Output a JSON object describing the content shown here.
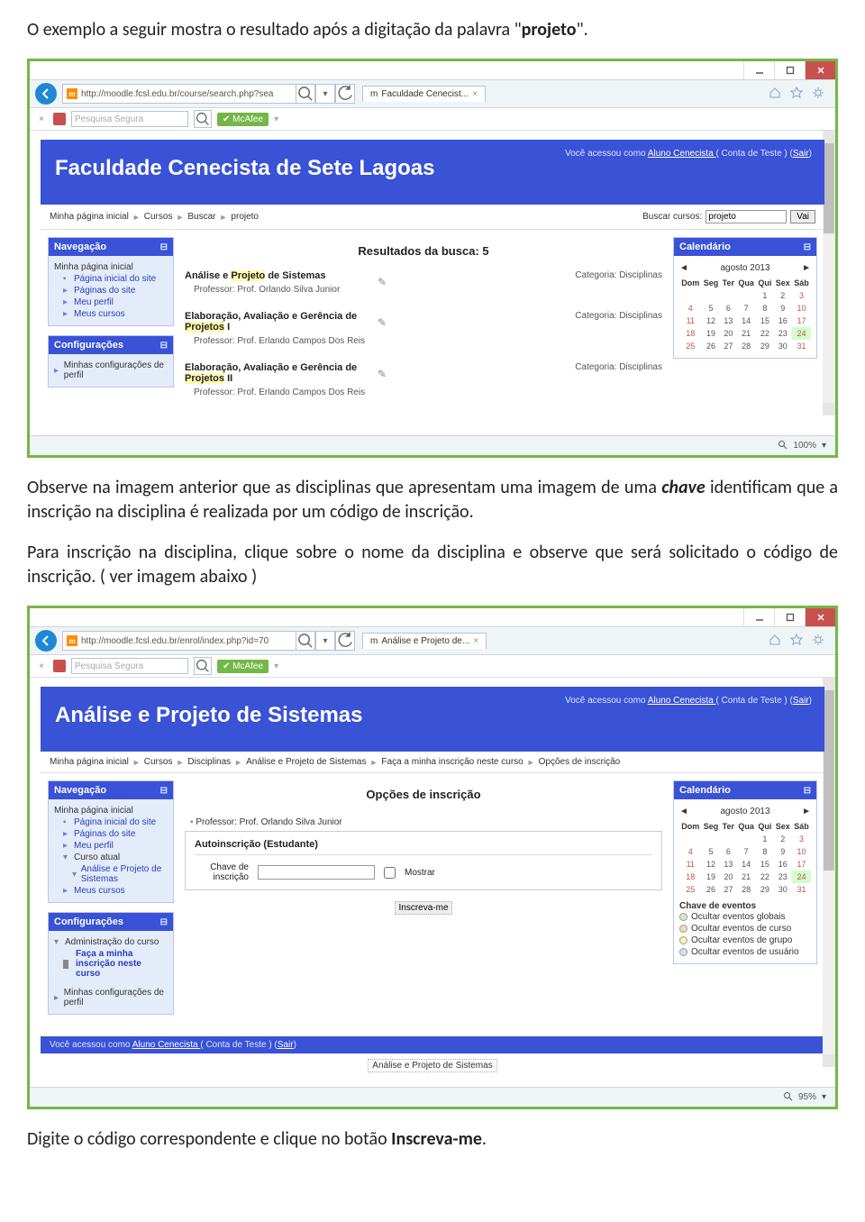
{
  "doc": {
    "p1_a": "O exemplo a seguir mostra o resultado após a digitação da palavra \"",
    "p1_b": "projeto",
    "p1_c": "\".",
    "p2_a": "Observe na imagem anterior que as disciplinas que apresentam uma imagem de uma ",
    "p2_b": "chave",
    "p2_c": " identificam que a inscrição na disciplina é realizada por um código de inscrição.",
    "p3": "Para inscrição na disciplina, clique sobre o nome da disciplina e observe que será solicitado o código de inscrição. ( ver imagem abaixo )",
    "p4_a": "Digite o código correspondente e clique no botão ",
    "p4_b": "Inscreva-me",
    "p4_c": "."
  },
  "chrome": {
    "url1": "http://moodle.fcsl.edu.br/course/search.php?sea",
    "url2": "http://moodle.fcsl.edu.br/enrol/index.php?id=70",
    "tab1": "Faculdade Cenecist...",
    "tab2": "Análise e Projeto de...",
    "search_placeholder": "Pesquisa Segura",
    "mcafee": "✔ McAfee",
    "zoom1": "100%",
    "zoom2": "95%"
  },
  "sc1": {
    "login_a": "Você acessou como ",
    "login_b": "Aluno Cenecista ",
    "login_c": "( Conta de Teste ) (",
    "login_d": "Sair",
    "login_e": ")",
    "site": "Faculdade Cenecista de Sete Lagoas",
    "bc": [
      "Minha página inicial",
      "Cursos",
      "Buscar",
      "projeto"
    ],
    "search_lbl": "Buscar cursos:",
    "search_val": "projeto",
    "search_btn": "Vai",
    "nav_title": "Navegação",
    "nav": [
      "Minha página inicial",
      "Página inicial do site",
      "Páginas do site",
      "Meu perfil",
      "Meus cursos"
    ],
    "cfg_title": "Configurações",
    "cfg": [
      "Minhas configurações de perfil"
    ],
    "results_title": "Resultados da busca: 5",
    "courses": [
      {
        "name_a": "Análise e ",
        "hl": "Projeto",
        "name_b": " de Sistemas",
        "teacher": "Professor: Prof. Orlando Silva Junior",
        "cat": "Categoria: Disciplinas"
      },
      {
        "name_a": "Elaboração, Avaliação e Gerência de ",
        "hl": "Projetos",
        "name_b": " I",
        "teacher": "Professor: Prof. Erlando Campos Dos Reis",
        "cat": "Categoria: Disciplinas"
      },
      {
        "name_a": "Elaboração, Avaliação e Gerência de ",
        "hl": "Projetos",
        "name_b": " II",
        "teacher": "Professor: Prof. Erlando Campos Dos Reis",
        "cat": "Categoria: Disciplinas"
      }
    ],
    "cal_title": "Calendário",
    "cal_month": "agosto 2013",
    "cal_dow": [
      "Dom",
      "Seg",
      "Ter",
      "Qua",
      "Qui",
      "Sex",
      "Sáb"
    ]
  },
  "sc2": {
    "site": "Análise e Projeto de Sistemas",
    "bc": [
      "Minha página inicial",
      "Cursos",
      "Disciplinas",
      "Análise e Projeto de Sistemas",
      "Faça a minha inscrição neste curso",
      "Opções de inscrição"
    ],
    "nav_title": "Navegação",
    "nav": [
      "Minha página inicial",
      "Página inicial do site",
      "Páginas do site",
      "Meu perfil",
      "Curso atual",
      "Análise e Projeto de Sistemas",
      "Meus cursos"
    ],
    "cfg_title": "Configurações",
    "cfg_admin": "Administração do curso",
    "cfg_enrol": "Faça a minha inscrição neste curso",
    "cfg_mine": "Minhas configurações de perfil",
    "main_title": "Opções de inscrição",
    "prof": "Professor: Prof. Orlando Silva Junior",
    "auto_head": "Autoinscrição (Estudante)",
    "key_lbl": "Chave de inscrição",
    "show_lbl": "Mostrar",
    "submit": "Inscreva-me",
    "cal_title": "Calendário",
    "cal_month": "agosto 2013",
    "ev_title": "Chave de eventos",
    "ev": [
      "Ocultar eventos globais",
      "Ocultar eventos de curso",
      "Ocultar eventos de grupo",
      "Ocultar eventos de usuário"
    ],
    "footer_course": "Análise e Projeto de Sistemas"
  }
}
